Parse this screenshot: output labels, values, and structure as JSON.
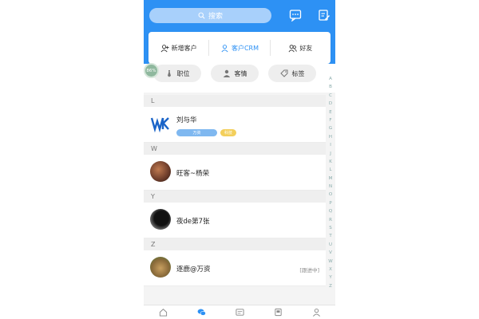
{
  "header": {
    "search_placeholder": "搜索",
    "bg_color": "#2d91f4"
  },
  "quick_actions": [
    {
      "label": "新增客户",
      "icon": "add-customer-icon"
    },
    {
      "label": "客户CRM",
      "icon": "crm-icon",
      "active": true
    },
    {
      "label": "好友",
      "icon": "friends-icon"
    }
  ],
  "chips": [
    {
      "label": "职位",
      "icon": "tie-icon"
    },
    {
      "label": "客情",
      "icon": "person-icon"
    },
    {
      "label": "标签",
      "icon": "tag-icon"
    }
  ],
  "badge": "86%",
  "sections": [
    {
      "letter": "L",
      "contacts": [
        {
          "name": "刘与华",
          "tags": [
            {
              "text": "万资",
              "color": "#7fb8f0"
            },
            {
              "text": "科技",
              "color": "#f3cf5b"
            }
          ]
        }
      ]
    },
    {
      "letter": "W",
      "contacts": [
        {
          "name": "旺客~杨荣"
        }
      ]
    },
    {
      "letter": "Y",
      "contacts": [
        {
          "name": "夜de第7张"
        }
      ]
    },
    {
      "letter": "Z",
      "contacts": [
        {
          "name": "逐鹿@万资",
          "status": "[跟进中]"
        }
      ]
    }
  ],
  "index_letters": [
    "A",
    "B",
    "C",
    "D",
    "E",
    "F",
    "G",
    "H",
    "I",
    "J",
    "K",
    "L",
    "M",
    "N",
    "O",
    "P",
    "Q",
    "R",
    "S",
    "T",
    "U",
    "V",
    "W",
    "X",
    "Y",
    "Z"
  ],
  "tabbar": [
    "home-icon",
    "chat-icon",
    "card-icon",
    "contacts-book-icon",
    "profile-icon"
  ]
}
